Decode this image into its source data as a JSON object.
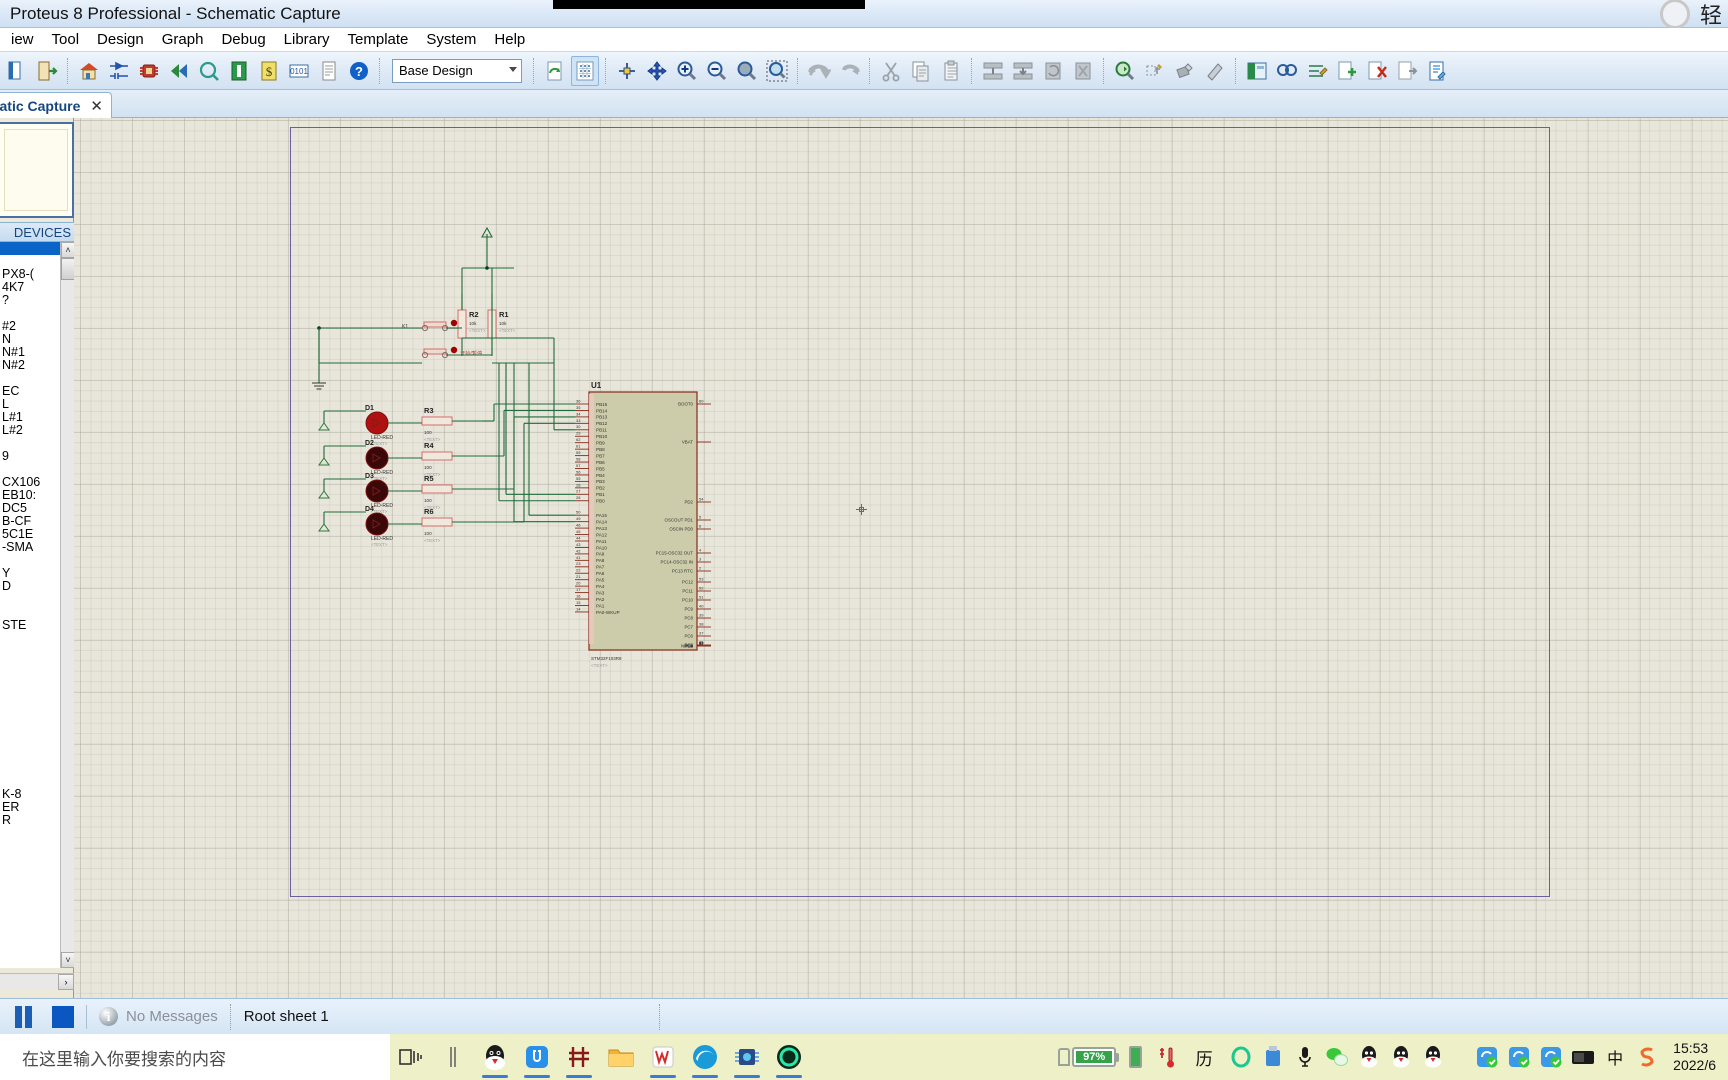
{
  "window": {
    "title": "Proteus 8 Professional - Schematic Capture",
    "ime_label": "轻"
  },
  "menu": {
    "items": [
      {
        "label": "iew"
      },
      {
        "label": "Tool"
      },
      {
        "label": "Design"
      },
      {
        "label": "Graph"
      },
      {
        "label": "Debug"
      },
      {
        "label": "Library"
      },
      {
        "label": "Template"
      },
      {
        "label": "System"
      },
      {
        "label": "Help"
      }
    ]
  },
  "toolbar": {
    "design_combo_value": "Base Design",
    "groups": [
      {
        "icons": [
          "new-project-icon",
          "open-project-icon"
        ]
      },
      {
        "icons": [
          "home-icon",
          "schematic-capture-icon",
          "pcb-layout-icon",
          "3d-viewer-icon",
          "simulation-icon",
          "bom-icon",
          "bill-of-materials-icon",
          "design-explorer-icon",
          "report-icon",
          "help-icon"
        ]
      },
      {
        "icons": [
          "refresh-icon",
          "grid-icon",
          "origin-icon",
          "pan-icon",
          "zoom-in-icon",
          "zoom-out-icon",
          "zoom-all-icon",
          "zoom-area-icon"
        ]
      },
      {
        "icons": [
          "undo-icon",
          "redo-icon"
        ]
      },
      {
        "icons": [
          "cut-icon",
          "copy-icon",
          "paste-icon"
        ]
      },
      {
        "icons": [
          "block-copy-icon",
          "block-move-icon",
          "block-rotate-icon",
          "block-delete-icon"
        ]
      },
      {
        "icons": [
          "pick-device-icon",
          "make-device-icon",
          "packaging-tool-icon",
          "decompose-icon"
        ]
      },
      {
        "icons": [
          "toggle-panel-icon",
          "property-assignment-icon",
          "netlist-icon",
          "add-sheet-icon",
          "remove-sheet-icon",
          "exit-sheet-icon",
          "design-notes-icon"
        ]
      }
    ]
  },
  "tab": {
    "label": "atic Capture",
    "close_glyph": "✕"
  },
  "left_panel": {
    "devices_header": "DEVICES",
    "selected_index": 0,
    "devices": [
      "",
      "",
      "PX8-(",
      "4K7",
      "?",
      "",
      "#2",
      "N",
      "N#1",
      "N#2",
      "",
      "EC",
      "L",
      "L#1",
      "L#2",
      "",
      "9",
      "",
      "CX106",
      "EB10:",
      "DC5",
      "B-CF",
      "5C1E",
      "-SMA",
      "",
      "Y",
      "D",
      "",
      "",
      "STE",
      "",
      "",
      "",
      "",
      "",
      "",
      "",
      "",
      "",
      "",
      "",
      "",
      "K-8",
      "ER",
      "R"
    ],
    "scroll_up_glyph": "˄",
    "scroll_down_glyph": "˅",
    "hscroll_right_glyph": "›"
  },
  "schematic": {
    "sheet_name": "Root sheet 1",
    "mcu": {
      "ref": "U1",
      "part": "STM32F103R8",
      "text_tag": "<TEXT>",
      "left_pins": [
        {
          "num": "36",
          "name": "PB15"
        },
        {
          "num": "35",
          "name": "PB14"
        },
        {
          "num": "34",
          "name": "PB13"
        },
        {
          "num": "33",
          "name": "PB12"
        },
        {
          "num": "30",
          "name": "PB11"
        },
        {
          "num": "29",
          "name": "PB10"
        },
        {
          "num": "62",
          "name": "PB9"
        },
        {
          "num": "61",
          "name": "PB8"
        },
        {
          "num": "59",
          "name": "PB7"
        },
        {
          "num": "58",
          "name": "PB6"
        },
        {
          "num": "57",
          "name": "PB5"
        },
        {
          "num": "56",
          "name": "PB4"
        },
        {
          "num": "55",
          "name": "PB3"
        },
        {
          "num": "28",
          "name": "PB2"
        },
        {
          "num": "27",
          "name": "PB1"
        },
        {
          "num": "26",
          "name": "PB0"
        },
        {
          "num": "50",
          "name": "PA15"
        },
        {
          "num": "49",
          "name": "PA14"
        },
        {
          "num": "46",
          "name": "PA13"
        },
        {
          "num": "45",
          "name": "PA12"
        },
        {
          "num": "44",
          "name": "PA11"
        },
        {
          "num": "43",
          "name": "PA10"
        },
        {
          "num": "42",
          "name": "PA9"
        },
        {
          "num": "41",
          "name": "PA8"
        },
        {
          "num": "23",
          "name": "PA7"
        },
        {
          "num": "22",
          "name": "PA6"
        },
        {
          "num": "21",
          "name": "PA5"
        },
        {
          "num": "20",
          "name": "PA4"
        },
        {
          "num": "17",
          "name": "PA3"
        },
        {
          "num": "16",
          "name": "PA2"
        },
        {
          "num": "15",
          "name": "PA1"
        },
        {
          "num": "14",
          "name": "PA0-WKUP"
        }
      ],
      "right_pins": [
        {
          "num": "60",
          "name": "BOOT0"
        },
        {
          "num": "",
          "name": "VBAT"
        },
        {
          "num": "54",
          "name": "PD2"
        },
        {
          "num": "5",
          "name": "OSCOUT PD1"
        },
        {
          "num": "6",
          "name": "OSCIN PD0"
        },
        {
          "num": "4",
          "name": "PC15-OSC32 OUT"
        },
        {
          "num": "3",
          "name": "PC14-OSC32 IN"
        },
        {
          "num": "2",
          "name": "PC13 RTC"
        },
        {
          "num": "53",
          "name": "PC12"
        },
        {
          "num": "52",
          "name": "PC11"
        },
        {
          "num": "51",
          "name": "PC10"
        },
        {
          "num": "40",
          "name": "PC9"
        },
        {
          "num": "39",
          "name": "PC8"
        },
        {
          "num": "38",
          "name": "PC7"
        },
        {
          "num": "37",
          "name": "PC6"
        },
        {
          "num": "25",
          "name": "PC5"
        },
        {
          "num": "24",
          "name": "PC4"
        },
        {
          "num": "11",
          "name": "PC3"
        },
        {
          "num": "10",
          "name": "PC2"
        },
        {
          "num": "9",
          "name": "PC1"
        },
        {
          "num": "8",
          "name": "PC0"
        },
        {
          "num": "7",
          "name": "NRST"
        }
      ]
    },
    "resistors": [
      {
        "ref": "R2",
        "value": "10k",
        "text_tag": "<TEXT>"
      },
      {
        "ref": "R1",
        "value": "10k",
        "text_tag": "<TEXT>"
      },
      {
        "ref": "R3",
        "value": "100",
        "text_tag": "<TEXT>"
      },
      {
        "ref": "R4",
        "value": "100",
        "text_tag": "<TEXT>"
      },
      {
        "ref": "R5",
        "value": "100",
        "text_tag": "<TEXT>"
      },
      {
        "ref": "R6",
        "value": "100",
        "text_tag": "<TEXT>"
      }
    ],
    "leds": [
      {
        "ref": "D1",
        "part": "LED-RED",
        "text_tag": "<TEXT>"
      },
      {
        "ref": "D2",
        "part": "LED-RED",
        "text_tag": "<TEXT>"
      },
      {
        "ref": "D3",
        "part": "LED-RED",
        "text_tag": "<TEXT>"
      },
      {
        "ref": "D4",
        "part": "LED-RED",
        "text_tag": "<TEXT>"
      }
    ],
    "switch": {
      "ref": "K1",
      "annotation": "开始/暂停"
    }
  },
  "statusbar": {
    "messages": "No Messages",
    "sheet": "Root sheet 1",
    "pause_icon": "pause-icon",
    "stop_icon": "stop-icon",
    "info_glyph": "i"
  },
  "taskbar": {
    "search_placeholder": "在这里输入你要搜索的内容",
    "battery_percent": "97%",
    "clock_time": "15:53",
    "clock_date": "2022/6",
    "ime_indicator": "中",
    "history_label": "历",
    "apps": [
      {
        "name": "task-view-icon"
      },
      {
        "name": "separator-icon"
      },
      {
        "name": "qq-icon"
      },
      {
        "name": "u-disk-icon"
      },
      {
        "name": "keil-icon"
      },
      {
        "name": "file-explorer-icon"
      },
      {
        "name": "wps-icon"
      },
      {
        "name": "edge-icon"
      },
      {
        "name": "proteus-icon"
      },
      {
        "name": "green-circle-icon"
      }
    ]
  },
  "colors": {
    "accent": "#1a5fb4",
    "sheet_border": "#6b5f9e",
    "wire": "#1f6b3a",
    "component_body": "#ccccaa",
    "pin_strip": "#e8c8c0",
    "led_red": "#a00000",
    "battery_green": "#36a34a",
    "canvas_bg": "#e8e6da"
  }
}
